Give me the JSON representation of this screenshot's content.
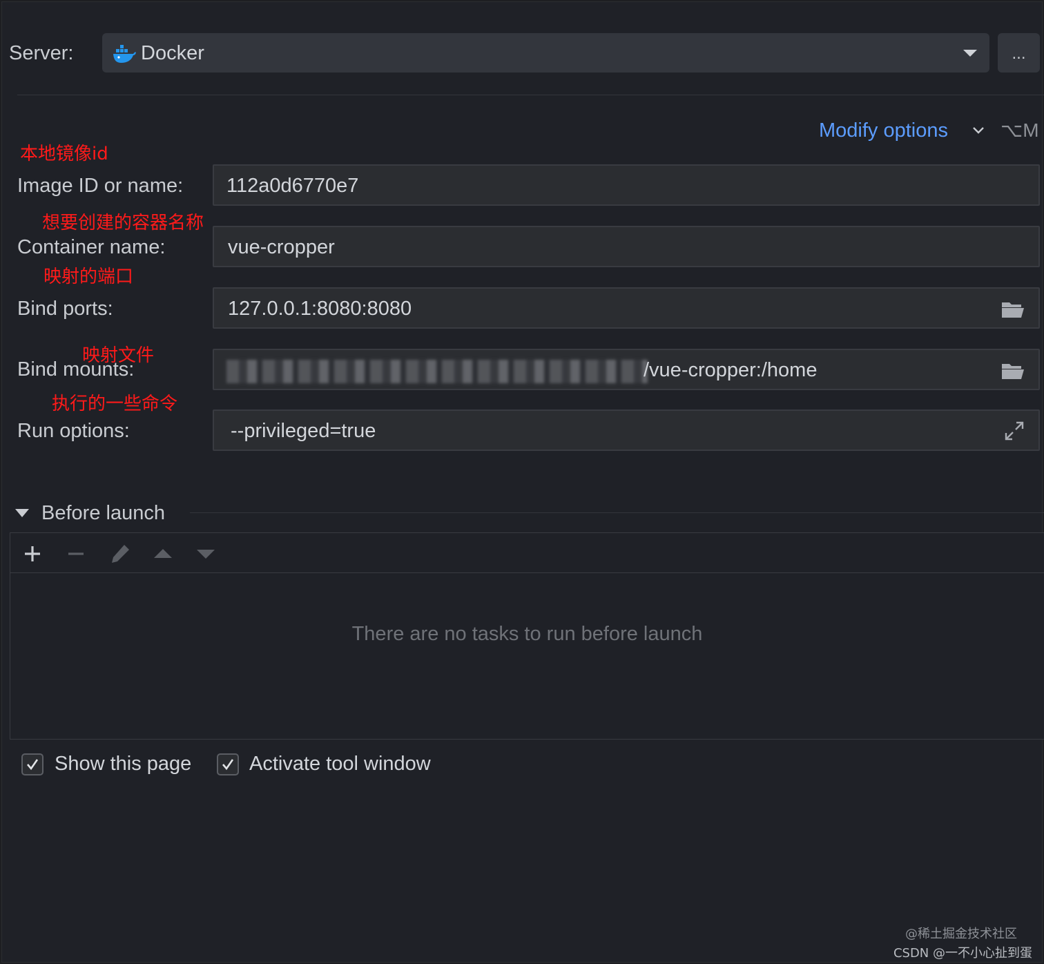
{
  "server": {
    "label": "Server:",
    "value": "Docker",
    "icon": "docker-icon",
    "more_label": "..."
  },
  "modify_options": {
    "label": "Modify options",
    "shortcut": "⌥M"
  },
  "annotations": {
    "image": "本地镜像id",
    "container": "想要创建的容器名称",
    "ports": "映射的端口",
    "mounts": "映射文件",
    "run": "执行的一些命令"
  },
  "fields": {
    "image": {
      "label": "Image ID or name:",
      "value": "112a0d6770e7"
    },
    "container": {
      "label": "Container name:",
      "value": "vue-cropper"
    },
    "ports": {
      "label": "Bind ports:",
      "value": "127.0.0.1:8080:8080"
    },
    "mounts": {
      "label": "Bind mounts:",
      "value": "/vue-cropper:/home"
    },
    "run": {
      "label": "Run options:",
      "value": "--privileged=true"
    }
  },
  "before_launch": {
    "title": "Before launch",
    "empty_message": "There are no tasks to run before launch",
    "toolbar": [
      "add-icon",
      "remove-icon",
      "edit-icon",
      "move-up-icon",
      "move-down-icon"
    ]
  },
  "checkboxes": {
    "show_page": {
      "label": "Show this page",
      "checked": true
    },
    "activate_tool": {
      "label": "Activate tool window",
      "checked": true
    }
  },
  "watermark": {
    "line1": "@稀土掘金技术社区",
    "line2": "CSDN @一不小心扯到蛋"
  },
  "colors": {
    "accent": "#5c9dff",
    "annotation": "#ff1a1a",
    "background": "#1f2127"
  }
}
